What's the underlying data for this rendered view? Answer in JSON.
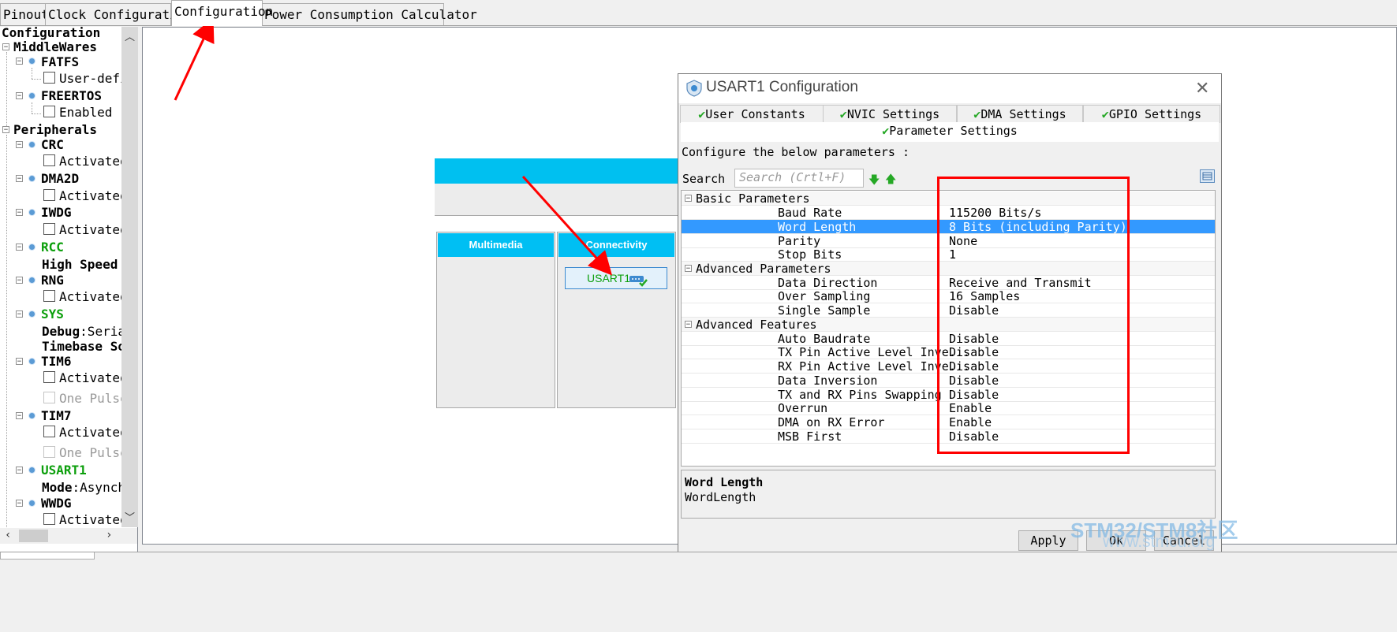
{
  "tabs": [
    "Pinout",
    "Clock Configuration",
    "Configuration",
    "Power Consumption Calculator"
  ],
  "tree": {
    "root": "Configuration",
    "middlewares": {
      "label": "MiddleWares",
      "fatfs": {
        "label": "FATFS",
        "option": "User-defin"
      },
      "freertos": {
        "label": "FREERTOS",
        "option": "Enabled"
      }
    },
    "peripherals": {
      "label": "Peripherals",
      "crc": {
        "label": "CRC",
        "option": "Activated"
      },
      "dma2d": {
        "label": "DMA2D",
        "option": "Activated"
      },
      "iwdg": {
        "label": "IWDG",
        "option": "Activated"
      },
      "rcc": {
        "label": "RCC",
        "sub_key": "High Speed",
        "sub_val": ""
      },
      "rng": {
        "label": "RNG",
        "option": "Activated"
      },
      "sys": {
        "label": "SYS",
        "debug_key": "Debug",
        "debug_val": ":Serial",
        "timebase_key": "Timebase So"
      },
      "tim6": {
        "label": "TIM6",
        "option": "Activated",
        "option2": "One Pulse"
      },
      "tim7": {
        "label": "TIM7",
        "option": "Activated",
        "option2": "One Pulse"
      },
      "usart1": {
        "label": "USART1",
        "mode_key": "Mode",
        "mode_val": ":Asynchr"
      },
      "wwdg": {
        "label": "WWDG",
        "option": "Activated"
      }
    }
  },
  "categories": {
    "multimedia": "Multimedia",
    "connectivity": "Connectivity",
    "usart1_button": "USART1"
  },
  "dialog": {
    "title": "USART1 Configuration",
    "close": "✕",
    "tabs": [
      "User Constants",
      "NVIC Settings",
      "DMA Settings",
      "GPIO Settings"
    ],
    "active_tab": "Parameter Settings",
    "instruction": "Configure the below parameters :",
    "search_label": "Search :",
    "search_placeholder": "Search (Crtl+F)",
    "groups": {
      "basic": "Basic Parameters",
      "advanced": "Advanced Parameters",
      "features": "Advanced Features"
    },
    "basic_params": [
      {
        "name": "Baud Rate",
        "value": "115200 Bits/s"
      },
      {
        "name": "Word Length",
        "value": "8 Bits (including Parity)"
      },
      {
        "name": "Parity",
        "value": "None"
      },
      {
        "name": "Stop Bits",
        "value": "1"
      }
    ],
    "advanced_params": [
      {
        "name": "Data Direction",
        "value": "Receive and Transmit"
      },
      {
        "name": "Over Sampling",
        "value": "16 Samples"
      },
      {
        "name": "Single Sample",
        "value": "Disable"
      }
    ],
    "advanced_features": [
      {
        "name": "Auto Baudrate",
        "value": "Disable"
      },
      {
        "name": "TX Pin Active Level Inve...",
        "value": "Disable"
      },
      {
        "name": "RX Pin Active Level Inve...",
        "value": "Disable"
      },
      {
        "name": "Data Inversion",
        "value": "Disable"
      },
      {
        "name": "TX and RX Pins Swapping",
        "value": "Disable"
      },
      {
        "name": "Overrun",
        "value": "Enable"
      },
      {
        "name": "DMA on RX Error",
        "value": "Enable"
      },
      {
        "name": "MSB First",
        "value": "Disable"
      }
    ],
    "desc_title": "Word Length",
    "desc_body": "WordLength",
    "apply": "Apply",
    "ok": "Ok",
    "cancel": "Cancel"
  },
  "watermark": {
    "line1": "STM32/STM8社区",
    "line2": "www.stmcu.org"
  },
  "colors": {
    "accent": "#00bff3",
    "selection": "#3399ff",
    "active_green": "#0c9f0c",
    "annotation_red": "#ff0000"
  }
}
